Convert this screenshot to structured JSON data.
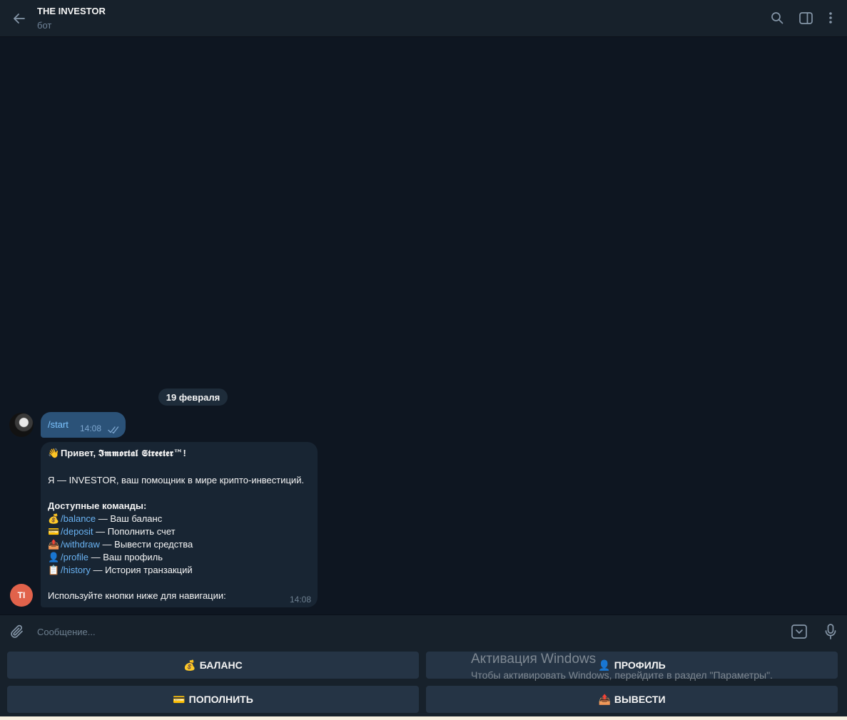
{
  "header": {
    "title": "THE INVESTOR",
    "subtitle": "бот"
  },
  "chat": {
    "date_label": "19 февраля",
    "outgoing": {
      "text": "/start",
      "time": "14:08"
    },
    "incoming": {
      "greeting_prefix": "Привет, ",
      "greeting_name": "𝕴𝖒𝖒𝖔𝖗𝖙𝖆𝖑 𝕾𝖙𝖗𝖊𝖊𝖙𝖊𝖗™",
      "greeting_suffix": "!",
      "intro": "Я — INVESTOR, ваш помощник в мире крипто-инвестиций.",
      "commands_heading": "Доступные команды:",
      "commands": [
        {
          "emoji": "💰",
          "cmd": "/balance",
          "desc": " — Ваш баланс"
        },
        {
          "emoji": "💳",
          "cmd": "/deposit",
          "desc": " — Пополнить счет"
        },
        {
          "emoji": "📤",
          "cmd": "/withdraw",
          "desc": " — Вывести средства"
        },
        {
          "emoji": "👤",
          "cmd": "/profile",
          "desc": " — Ваш профиль"
        },
        {
          "emoji": "📋",
          "cmd": "/history",
          "desc": " — История транзакций"
        }
      ],
      "footer": "Используйте кнопки ниже для навигации:",
      "time": "14:08",
      "bot_avatar_initials": "TI"
    }
  },
  "composer": {
    "placeholder": "Сообщение..."
  },
  "keyboard": {
    "buttons": [
      {
        "emoji": "💰",
        "label": "БАЛАНС"
      },
      {
        "emoji": "👤",
        "label": "ПРОФИЛЬ"
      },
      {
        "emoji": "💳",
        "label": "ПОПОЛНИТЬ"
      },
      {
        "emoji": "📤",
        "label": "ВЫВЕСТИ"
      }
    ]
  },
  "watermark": {
    "line1": "Активация Windows",
    "line2": "Чтобы активировать Windows, перейдите в раздел \"Параметры\"."
  },
  "colors": {
    "background": "#0e1621",
    "panel": "#17212b",
    "outgoing_bubble": "#2b5278",
    "incoming_bubble": "#182533",
    "link": "#6ab3f3",
    "bot_avatar": "#e1624b"
  }
}
